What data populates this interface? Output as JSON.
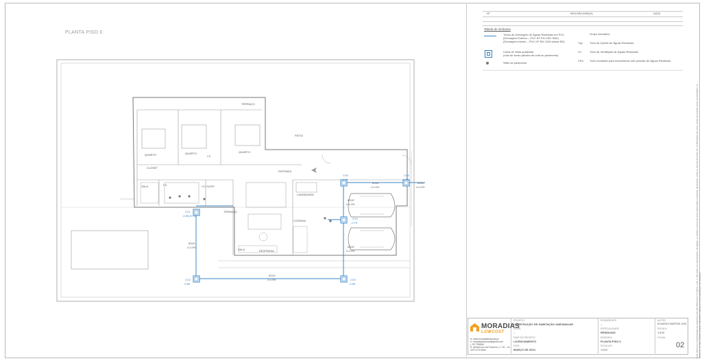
{
  "drawing": {
    "title": "PLANTA PISO 0"
  },
  "revisions": {
    "headers": [
      "Nº",
      "REVISÃO/OBS(S)",
      "DATA"
    ]
  },
  "legend": {
    "title": "Tabela de símbolos",
    "items": [
      {
        "text": "Tubos de Drenagem de Águas Residuais em PVC\n(Drenagem Exterior – PVC KP EN 1401 SN4)\n(Drenagem Interior – PVC KP EN 1329 classe BD)",
        "icon": "blue-line"
      },
      {
        "text": "Caixa de visita quadrada\n(cota de fundo (abaixo da cota do pavimento)",
        "icon": "square-manhole"
      },
      {
        "text": "Sifão de pavimento",
        "icon": "floor-drain"
      }
    ],
    "right_items": [
      {
        "code": "",
        "text": "Grupo elevatório"
      },
      {
        "code": "Tqo",
        "text": "Tubo de Queda de Águas Residuais"
      },
      {
        "code": "Vn",
        "text": "Tubo de Ventilação de Águas Residuais"
      },
      {
        "code": "CRn",
        "text": "Tubo montante para escoamento sob pressão de Águas Residuais"
      }
    ]
  },
  "plan_labels": {
    "cv": [
      {
        "id": "CV1",
        "cota": "-0.85 (0.70)"
      },
      {
        "id": "CV2",
        "cota": "-0.85"
      },
      {
        "id": "CV3",
        "cota": "-0.85"
      },
      {
        "id": "CV4",
        "cota": "-0.75"
      },
      {
        "id": "CV5",
        "cota": "-0.70"
      },
      {
        "id": "CV6",
        "cota": "-0.70"
      }
    ],
    "pipes": [
      {
        "d": "Ø110",
        "i": "i=1.0%"
      },
      {
        "d": "Ø110",
        "i": "i=1.0%"
      },
      {
        "d": "Ø110",
        "i": "i=1.0%"
      },
      {
        "d": "Ø110",
        "i": "i=1.0%"
      },
      {
        "d": "Ø110",
        "i": "i=1.0%"
      },
      {
        "d": "Ø110",
        "i": "i=1.0%"
      }
    ],
    "rooms": [
      "TERRAÇO",
      "QUARTO",
      "CLOSET",
      "QUARTO",
      "QUARTO",
      "I.S.",
      "I.S.",
      "I.S. SUITE",
      "LAVANDARIA",
      "COZINHA",
      "SALA",
      "ENTRADA",
      "DESPENSA",
      "TERRAÇO",
      "SALA",
      "PÁTIO"
    ]
  },
  "titleblock": {
    "logo_word": "MORADIAS",
    "logo_sub": "LOWCOST",
    "contacts": [
      "w. www.moradiaslowcost.pt",
      "e. moradiaslowcost@gmail.com",
      "t. 917755806",
      "R. Anibal Lino da Fonseca, n.º 32 – r/c",
      "4470-475 Maia"
    ],
    "fields": [
      {
        "label": "PROJETO",
        "value": "CONSTRUÇÃO DE HABITAÇÃO UNIFAMILIAR"
      },
      {
        "label": "LOCAL",
        "value": "–"
      },
      {
        "label": "FASE DO PROJETO",
        "value": "LICENCIAMENTO"
      },
      {
        "label": "DATA",
        "value": "MARÇO DE 2024"
      }
    ],
    "fields_mid": [
      {
        "label": "REQUERENTE",
        "value": "–"
      },
      {
        "label": "ESPECIALIDADE",
        "value": "RESIDUAIS"
      },
      {
        "label": "DESENHO",
        "value": "PLANTA PISO 0"
      },
      {
        "label": "ESCALA/S",
        "value": "1/100"
      }
    ],
    "fields_right": [
      {
        "label": "AUTOR",
        "value": "EDUARDO MARTINS, ENG."
      },
      {
        "label": "ESCALA",
        "value": "1/100"
      },
      {
        "label": "FOLHA",
        "value": ""
      }
    ],
    "sheet_number": "02"
  },
  "side_note": "Este desenho é propriedade da empresa Solução Eficiente e Projetos, Lda. e não pode ser reproduzido, divulgado ou cedido a terceiros sem autorização expressa. Quaisquer cotas ou alturas deverão ser confirmadas em obra, tendo prioridade sobre as medições no desenho. O não respeito destas indicações implica a responsabilidade do utilizador."
}
